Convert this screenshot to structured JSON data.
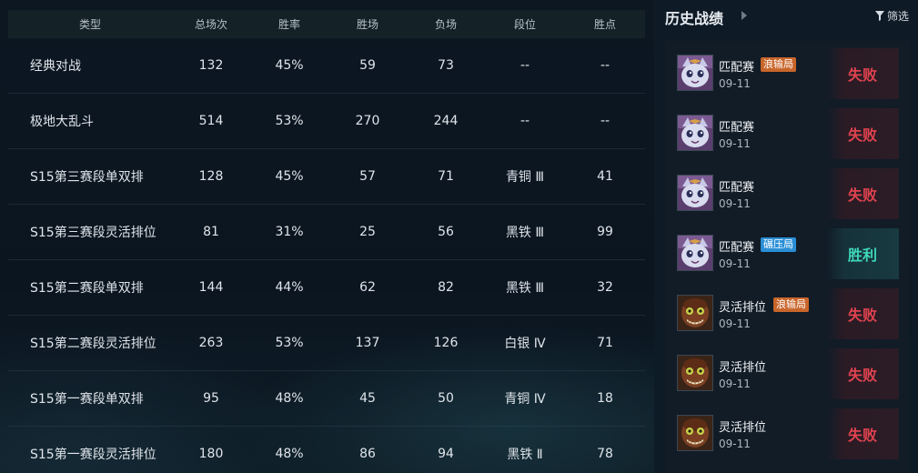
{
  "stats": {
    "headers": {
      "type": "类型",
      "total": "总场次",
      "rate": "胜率",
      "wins": "胜场",
      "losses": "负场",
      "tier": "段位",
      "lp": "胜点"
    },
    "rows": [
      {
        "type": "经典对战",
        "total": "132",
        "rate": "45%",
        "wins": "59",
        "losses": "73",
        "tier": "--",
        "lp": "--"
      },
      {
        "type": "极地大乱斗",
        "total": "514",
        "rate": "53%",
        "wins": "270",
        "losses": "244",
        "tier": "--",
        "lp": "--"
      },
      {
        "type": "S15第三赛段单双排",
        "total": "128",
        "rate": "45%",
        "wins": "57",
        "losses": "71",
        "tier": "青铜 Ⅲ",
        "lp": "41"
      },
      {
        "type": "S15第三赛段灵活排位",
        "total": "81",
        "rate": "31%",
        "wins": "25",
        "losses": "56",
        "tier": "黑铁 Ⅲ",
        "lp": "99"
      },
      {
        "type": "S15第二赛段单双排",
        "total": "144",
        "rate": "44%",
        "wins": "62",
        "losses": "82",
        "tier": "黑铁 Ⅲ",
        "lp": "32"
      },
      {
        "type": "S15第二赛段灵活排位",
        "total": "263",
        "rate": "53%",
        "wins": "137",
        "losses": "126",
        "tier": "白银 Ⅳ",
        "lp": "71"
      },
      {
        "type": "S15第一赛段单双排",
        "total": "95",
        "rate": "48%",
        "wins": "45",
        "losses": "50",
        "tier": "青铜 Ⅳ",
        "lp": "18"
      },
      {
        "type": "S15第一赛段灵活排位",
        "total": "180",
        "rate": "48%",
        "wins": "86",
        "losses": "94",
        "tier": "黑铁 Ⅱ",
        "lp": "78"
      }
    ]
  },
  "history": {
    "title": "历史战绩",
    "filter_label": "筛选",
    "filter_icon": "filter-icon",
    "colors": {
      "lose": "#e0434f",
      "win": "#3fd8b8",
      "tag_orange": "#c8652a",
      "tag_blue": "#2a8fd6"
    },
    "matches": [
      {
        "mode": "匹配赛",
        "tag": "浪输局",
        "tag_color": "orange",
        "date": "09-11",
        "result": "失败",
        "outcome": "lose",
        "champion_icon": "cat-champion-icon"
      },
      {
        "mode": "匹配赛",
        "tag": "",
        "tag_color": "",
        "date": "09-11",
        "result": "失败",
        "outcome": "lose",
        "champion_icon": "cat-champion-icon"
      },
      {
        "mode": "匹配赛",
        "tag": "",
        "tag_color": "",
        "date": "09-11",
        "result": "失败",
        "outcome": "lose",
        "champion_icon": "cat-champion-icon"
      },
      {
        "mode": "匹配赛",
        "tag": "碾压局",
        "tag_color": "blue",
        "date": "09-11",
        "result": "胜利",
        "outcome": "win",
        "champion_icon": "cat-champion-icon"
      },
      {
        "mode": "灵活排位",
        "tag": "浪输局",
        "tag_color": "orange",
        "date": "09-11",
        "result": "失败",
        "outcome": "lose",
        "champion_icon": "goblin-champion-icon"
      },
      {
        "mode": "灵活排位",
        "tag": "",
        "tag_color": "",
        "date": "09-11",
        "result": "失败",
        "outcome": "lose",
        "champion_icon": "goblin-champion-icon"
      },
      {
        "mode": "灵活排位",
        "tag": "",
        "tag_color": "",
        "date": "09-11",
        "result": "失败",
        "outcome": "lose",
        "champion_icon": "goblin-champion-icon"
      }
    ]
  }
}
